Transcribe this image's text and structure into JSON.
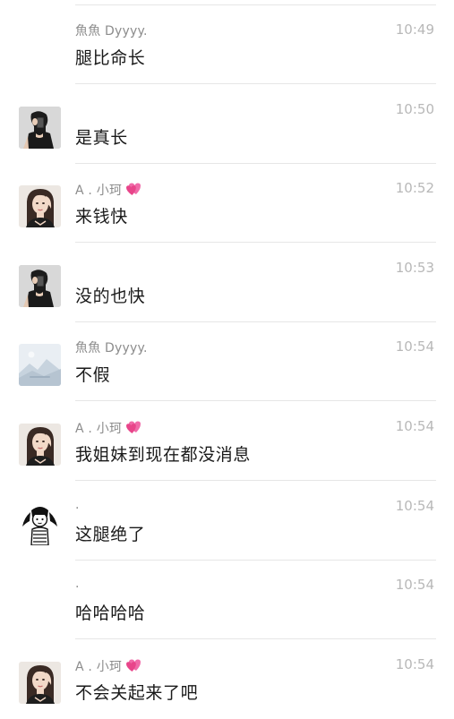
{
  "colors": {
    "name": "#8c8c8c",
    "time": "#b8b8b8",
    "text": "#1a1a1a",
    "divider": "#e6e6e6",
    "heart": "#e8458a"
  },
  "messages": [
    {
      "avatar": "none",
      "name": "魚魚 Dyyyy.",
      "heart": false,
      "time": "10:49",
      "text": "腿比命长"
    },
    {
      "avatar": "mirror-selfie",
      "name": "",
      "heart": false,
      "time": "10:50",
      "text": "是真长"
    },
    {
      "avatar": "girl-portrait",
      "name": "A . 小珂",
      "heart": true,
      "time": "10:52",
      "text": "来钱快"
    },
    {
      "avatar": "mirror-selfie",
      "name": "",
      "heart": false,
      "time": "10:53",
      "text": "没的也快"
    },
    {
      "avatar": "image-placeholder",
      "name": "魚魚 Dyyyy.",
      "heart": false,
      "time": "10:54",
      "text": "不假"
    },
    {
      "avatar": "girl-portrait",
      "name": "A . 小珂",
      "heart": true,
      "time": "10:54",
      "text": "我姐妹到现在都没消息"
    },
    {
      "avatar": "cartoon-girl",
      "name": ".",
      "heart": false,
      "time": "10:54",
      "text": "这腿绝了"
    },
    {
      "avatar": "none",
      "name": ".",
      "heart": false,
      "time": "10:54",
      "text": "哈哈哈哈"
    },
    {
      "avatar": "girl-portrait",
      "name": "A . 小珂",
      "heart": true,
      "time": "10:54",
      "text": "不会关起来了吧"
    }
  ]
}
